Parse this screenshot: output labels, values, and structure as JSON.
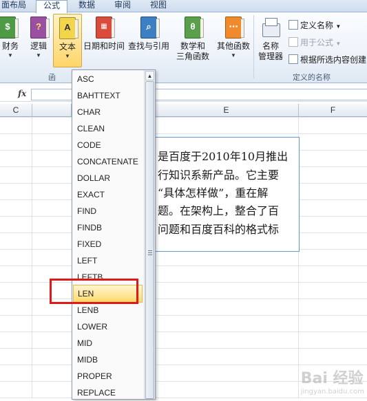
{
  "ribbon": {
    "tabs": [
      {
        "label": "面布局",
        "active": false
      },
      {
        "label": "公式",
        "active": true
      },
      {
        "label": "数据",
        "active": false
      },
      {
        "label": "审阅",
        "active": false
      },
      {
        "label": "视图",
        "active": false
      }
    ],
    "buttons": [
      {
        "label": "财务",
        "icon": "finance-book-icon",
        "color": "#4f9a47"
      },
      {
        "label": "逻辑",
        "icon": "logic-book-icon",
        "color": "#9a4fa0"
      },
      {
        "label": "文本",
        "icon": "text-book-icon",
        "color": "#f0d34a",
        "active": true
      },
      {
        "label": "日期和时间",
        "icon": "datetime-book-icon",
        "color": "#d94b3a"
      },
      {
        "label": "查找与引用",
        "icon": "lookup-book-icon",
        "color": "#3c7fc2"
      },
      {
        "label": "数学和\n三角函数",
        "icon": "math-book-icon",
        "color": "#5aa04c"
      },
      {
        "label": "其他函数",
        "icon": "more-functions-book-icon",
        "color": "#f08a2c"
      }
    ],
    "group_fragment": "函",
    "names": {
      "manager_label_1": "名称",
      "manager_label_2": "管理器",
      "define_name": "定义名称",
      "use_in_formula": "用于公式",
      "create_from_selection": "根据所选内容创建",
      "group_label": "定义的名称"
    }
  },
  "formula_bar": {
    "fx": "fx",
    "value": ""
  },
  "columns": [
    "C",
    "E",
    "F"
  ],
  "textbox_lines": [
    "是百度于2010年10月推出",
    "行知识系新产品。它主要",
    "“具体怎样做”，重在解",
    "题。在架构上，整合了百",
    "问题和百度百科的格式标"
  ],
  "dropdown": {
    "items": [
      "ASC",
      "BAHTTEXT",
      "CHAR",
      "CLEAN",
      "CODE",
      "CONCATENATE",
      "DOLLAR",
      "EXACT",
      "FIND",
      "FINDB",
      "FIXED",
      "LEFT",
      "LEFTB",
      "LEN",
      "LENB",
      "LOWER",
      "MID",
      "MIDB",
      "PROPER",
      "REPLACE"
    ],
    "highlighted": "LEN"
  },
  "watermark": {
    "main": "Bai 经验",
    "sub": "jingyan.baidu.com"
  }
}
